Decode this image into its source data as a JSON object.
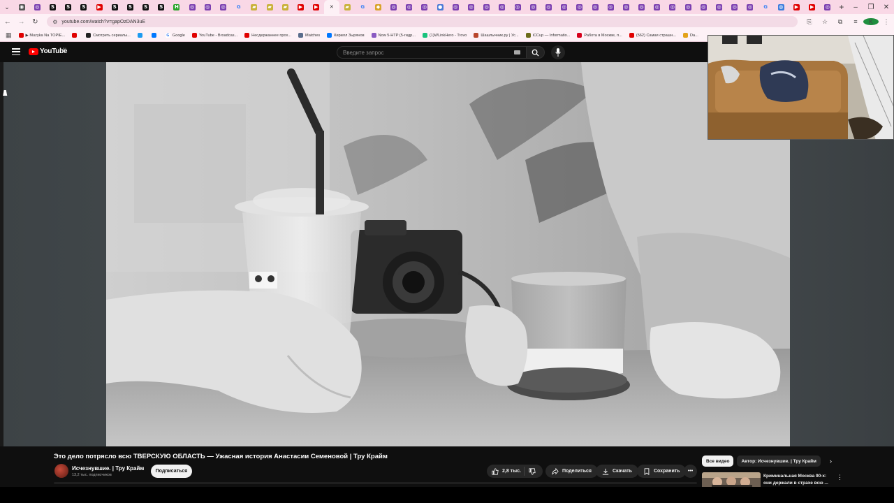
{
  "browser": {
    "tab_favicons": [
      "chrome",
      "ring",
      "s",
      "s",
      "s",
      "yt",
      "s",
      "s",
      "s",
      "s",
      "h",
      "ring",
      "ring",
      "ring",
      "g",
      "folder",
      "folder",
      "folder",
      "yt",
      "yt",
      "close",
      "folder",
      "g",
      "bolt",
      "ring",
      "ring",
      "ring",
      "dot",
      "ring",
      "ring",
      "ring",
      "ring",
      "ring",
      "ring",
      "ring",
      "ring",
      "ring",
      "ring",
      "ring",
      "ring",
      "ring",
      "ring",
      "ring",
      "ring",
      "ring",
      "ring",
      "ring",
      "ring",
      "g",
      "globe",
      "yt",
      "yt",
      "ring"
    ],
    "new_tab_label": "+",
    "url": "youtube.com/watch?v=gapOzDAN3uE",
    "profile_initial": "K",
    "bookmarks": [
      {
        "icon": "yt",
        "label": "▶ Muzyka Na TOPIE..."
      },
      {
        "icon": "yt",
        "label": ""
      },
      {
        "icon": "a",
        "label": "Смотреть сериалы..."
      },
      {
        "icon": "twitter",
        "label": ""
      },
      {
        "icon": "vk",
        "label": ""
      },
      {
        "icon": "g",
        "label": "Google"
      },
      {
        "icon": "yt",
        "label": "YouTube - Broadcas..."
      },
      {
        "icon": "yt",
        "label": "Несдержаннее прох..."
      },
      {
        "icon": "m",
        "label": "Matches"
      },
      {
        "icon": "vk",
        "label": "Кирилл Зырянов"
      },
      {
        "icon": "n",
        "label": "Now 5-HTP (5-гидр..."
      },
      {
        "icon": "t",
        "label": "(1)WLinkHero - Trovo"
      },
      {
        "icon": "shash",
        "label": "Шашлычник.ру | Ус..."
      },
      {
        "icon": "icup",
        "label": "iCCup — Informatio..."
      },
      {
        "icon": "hh",
        "label": "Работа в Москве, п..."
      },
      {
        "icon": "yt",
        "label": "(562) Самая страшн..."
      },
      {
        "icon": "star",
        "label": "Da..."
      }
    ]
  },
  "youtube": {
    "logo_text": "YouTube",
    "country_code": "BY",
    "search_placeholder": "Введите запрос",
    "video": {
      "title": "Это дело потрясло всю ТВЕРСКУЮ ОБЛАСТЬ — Ужасная история Анастасии Семеновой | Тру Крайм",
      "channel_name": "Исчезнувшие. | Тру Крайм",
      "subscribers": "13,2 тыс. подписчиков",
      "subscribe_label": "Подписаться",
      "likes": "2,8 тыс.",
      "share_label": "Поделиться",
      "download_label": "Скачать",
      "save_label": "Сохранить"
    },
    "chips": [
      "Все видео",
      "Автор: Исчезнувшие. | Тру Крайм"
    ],
    "recommendation": {
      "title": "Криминальная Москва 90-х: они держали в страхе всю ..."
    }
  },
  "colors": {
    "yt_red": "#ff0000",
    "tab_strip": "#f9d8e6",
    "toolbar": "#fdf1f6"
  }
}
